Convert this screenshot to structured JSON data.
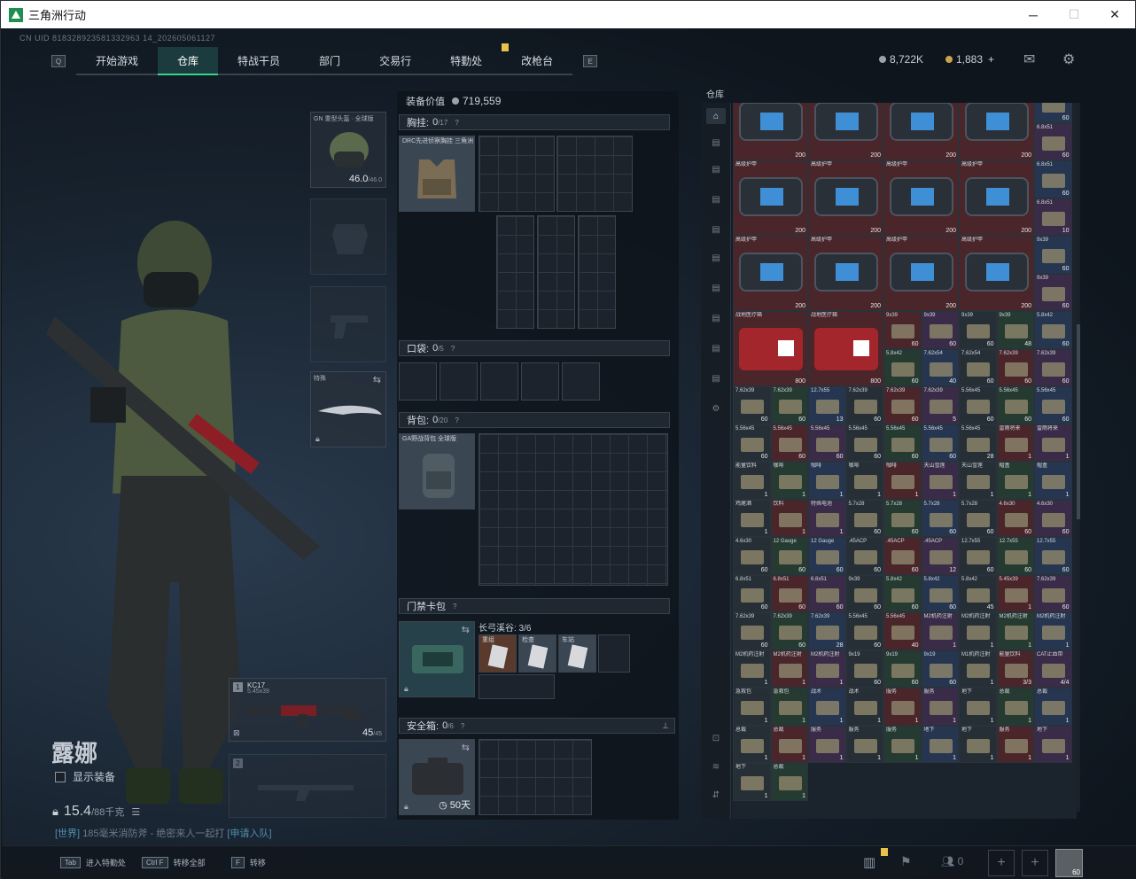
{
  "window": {
    "title": "三角洲行动",
    "min": "─",
    "max": "☐",
    "close": "✕"
  },
  "uid": "CN UID 818328923581332963 14_202605061127",
  "nav": {
    "tabs": [
      {
        "label": "开始游戏"
      },
      {
        "label": "仓库"
      },
      {
        "label": "特战干员"
      },
      {
        "label": "部门"
      },
      {
        "label": "交易行"
      },
      {
        "label": "特勤处"
      },
      {
        "label": "改枪台"
      }
    ],
    "left_key": "Q",
    "right_key": "E"
  },
  "currency": {
    "silver": "8,722K",
    "gold": "1,883",
    "plus": "+"
  },
  "operator": {
    "name": "露娜",
    "show_equipment": "显示装备",
    "weight": "15.4",
    "weight_max": "/88千克",
    "chat_channel": "[世界]",
    "chat_text": "185毫米消防斧 - 绝密来人一起打",
    "chat_link": "[申请入队]"
  },
  "gear": {
    "helmet": {
      "label": "GN 重型头盔 · 全球版",
      "durability": "46.0",
      "max": "/46.0"
    },
    "melee": {
      "label": "特殊"
    },
    "primary": {
      "index": "1",
      "name": "KC17",
      "ammo_type": "5.45x39",
      "ammo": "45",
      "ammo_max": "/45"
    },
    "secondary": {
      "index": "2"
    }
  },
  "equipment": {
    "value_label": "装备价值",
    "value": "719,559",
    "chest": {
      "label": "胸挂:",
      "count": "0",
      "max": "/17",
      "item": "DRC先进侦察胸挂 三角洲"
    },
    "pocket": {
      "label": "口袋:",
      "count": "0",
      "max": "/5"
    },
    "backpack": {
      "label": "背包:",
      "count": "0",
      "max": "/20",
      "item": "GA野战背包 全球版"
    },
    "keycard": {
      "label": "门禁卡包",
      "sub": "长弓溪谷: 3/6",
      "cards": [
        "重组",
        "检查",
        "车站"
      ]
    },
    "safebox": {
      "label": "安全箱:",
      "count": "0",
      "max": "/6",
      "timer": "50天"
    }
  },
  "stash": {
    "title": "仓库",
    "items": [
      {
        "n": "",
        "c": "200",
        "r": "red"
      },
      {
        "n": "",
        "c": "200",
        "r": "red"
      },
      {
        "n": "",
        "c": "200",
        "r": "red"
      },
      {
        "n": "",
        "c": "200",
        "r": "red"
      },
      {
        "n": "高级护甲",
        "c": "200",
        "r": "red"
      },
      {
        "n": "高级护甲",
        "c": "200",
        "r": "red"
      },
      {
        "n": "高级护甲",
        "c": "200",
        "r": "red"
      },
      {
        "n": "高级护甲",
        "c": "200",
        "r": "red"
      },
      {
        "n": "高级护甲",
        "c": "200",
        "r": "red"
      },
      {
        "n": "高级护甲",
        "c": "200",
        "r": "red"
      },
      {
        "n": "高级护甲",
        "c": "200",
        "r": "red"
      },
      {
        "n": "高级护甲",
        "c": "200",
        "r": "red"
      },
      {
        "n": "战地医疗箱",
        "c": "800",
        "r": "red"
      },
      {
        "n": "战地医疗箱",
        "c": "800",
        "r": "red"
      }
    ],
    "small": [
      [
        "6.8x51",
        "60"
      ],
      [
        "6.8x51",
        "60"
      ],
      [
        "6.8x51",
        "60"
      ],
      [
        "6.8x51",
        "10"
      ],
      [
        "9x39",
        "60"
      ],
      [
        "9x39",
        "60"
      ],
      [
        "9x39",
        "60"
      ],
      [
        "9x39",
        "60"
      ],
      [
        "9x39",
        "60"
      ],
      [
        "9x39",
        "48"
      ],
      [
        "5.8x42",
        "60"
      ],
      [
        "5.8x42",
        "60"
      ],
      [
        "7.62x54",
        "40"
      ],
      [
        "7.62x54",
        "60"
      ],
      [
        "7.62x39",
        "60"
      ],
      [
        "7.62x39",
        "60"
      ],
      [
        "7.62x39",
        "60"
      ],
      [
        "7.62x39",
        "60"
      ],
      [
        "12.7x55",
        "13"
      ],
      [
        "7.62x39",
        "60"
      ],
      [
        "7.62x39",
        "60"
      ],
      [
        "7.62x39",
        "5"
      ],
      [
        "5.56x45",
        "60"
      ],
      [
        "5.56x45",
        "60"
      ],
      [
        "5.56x45",
        "60"
      ],
      [
        "5.56x45",
        "60"
      ],
      [
        "5.56x45",
        "60"
      ],
      [
        "5.56x45",
        "60"
      ],
      [
        "5.56x45",
        "60"
      ],
      [
        "5.56x45",
        "60"
      ],
      [
        "5.56x45",
        "60"
      ],
      [
        "5.56x45",
        "28"
      ],
      [
        "雷雨将来",
        "1"
      ],
      [
        "雷雨将来",
        "1"
      ],
      [
        "能量饮料",
        "1"
      ],
      [
        "咖啡",
        "1"
      ],
      [
        "咖啡",
        "1"
      ],
      [
        "咖啡",
        "1"
      ],
      [
        "咖啡",
        "1"
      ],
      [
        "天山雪莲",
        "1"
      ],
      [
        "天山雪莲",
        "1"
      ],
      [
        "帽盒",
        "1"
      ],
      [
        "帽盒",
        "1"
      ],
      [
        "鸡尾酒",
        "1"
      ],
      [
        "饮料",
        "1"
      ],
      [
        "特殊电池",
        "1"
      ],
      [
        "5.7x28",
        "60"
      ],
      [
        "5.7x28",
        "60"
      ],
      [
        "5.7x28",
        "60"
      ],
      [
        "5.7x28",
        "60"
      ],
      [
        "4.6x30",
        "60"
      ],
      [
        "4.6x30",
        "60"
      ],
      [
        "4.6x30",
        "60"
      ],
      [
        "12 Gauge",
        "60"
      ],
      [
        "12 Gauge",
        "60"
      ],
      [
        ".45ACP",
        "60"
      ],
      [
        ".45ACP",
        "60"
      ],
      [
        ".45ACP",
        "12"
      ],
      [
        "12.7x55",
        "60"
      ],
      [
        "12.7x55",
        "60"
      ],
      [
        "12.7x55",
        "60"
      ],
      [
        "6.8x51",
        "60"
      ],
      [
        "6.8x51",
        "60"
      ],
      [
        "6.8x51",
        "60"
      ],
      [
        "9x39",
        "60"
      ],
      [
        "5.8x42",
        "60"
      ],
      [
        "5.8x42",
        "60"
      ],
      [
        "5.8x42",
        "45"
      ],
      [
        "5.45x39",
        "1"
      ],
      [
        "7.62x39",
        "60"
      ],
      [
        "7.62x39",
        "60"
      ],
      [
        "7.62x39",
        "60"
      ],
      [
        "7.62x39",
        "28"
      ],
      [
        "5.56x45",
        "60"
      ],
      [
        "5.56x45",
        "40"
      ],
      [
        "M2机药注射",
        "1"
      ],
      [
        "M2机药注射",
        "1"
      ],
      [
        "M2机药注射",
        "1"
      ],
      [
        "M2机药注射",
        "1"
      ],
      [
        "M2机药注射",
        "1"
      ],
      [
        "M2机药注射",
        "1"
      ],
      [
        "M2机药注射",
        "1"
      ],
      [
        "9x19",
        "60"
      ],
      [
        "9x19",
        "60"
      ],
      [
        "9x19",
        "60"
      ],
      [
        "M1机药注射",
        "1"
      ],
      [
        "能量饮料",
        "3/3"
      ],
      [
        "CAT止血带",
        "4/4"
      ],
      [
        "急救包",
        "1"
      ],
      [
        "急救包",
        "1"
      ],
      [
        "战术",
        "1"
      ],
      [
        "战术",
        "1"
      ],
      [
        "服务",
        "1"
      ],
      [
        "服务",
        "1"
      ],
      [
        "地下",
        "1"
      ],
      [
        "总裁",
        "1"
      ],
      [
        "总裁",
        "1"
      ],
      [
        "总裁",
        "1"
      ],
      [
        "总裁",
        "1"
      ],
      [
        "服务",
        "1"
      ],
      [
        "服务",
        "1"
      ],
      [
        "服务",
        "1"
      ],
      [
        "地下",
        "1"
      ],
      [
        "地下",
        "1"
      ],
      [
        "服务",
        "1"
      ],
      [
        "地下",
        "1"
      ],
      [
        "地下",
        "1"
      ],
      [
        "总裁",
        "1"
      ]
    ]
  },
  "bottom": {
    "hints": [
      {
        "key": "Tab",
        "label": "进入特勤处"
      },
      {
        "key": "Ctrl F",
        "label": "转移全部"
      },
      {
        "key": "F",
        "label": "转移"
      }
    ],
    "squad_count": "0",
    "avatar_level": "60"
  },
  "colors": {
    "accent": "#35d48b",
    "gold": "#e8c24a",
    "bg": "#0e141b"
  }
}
